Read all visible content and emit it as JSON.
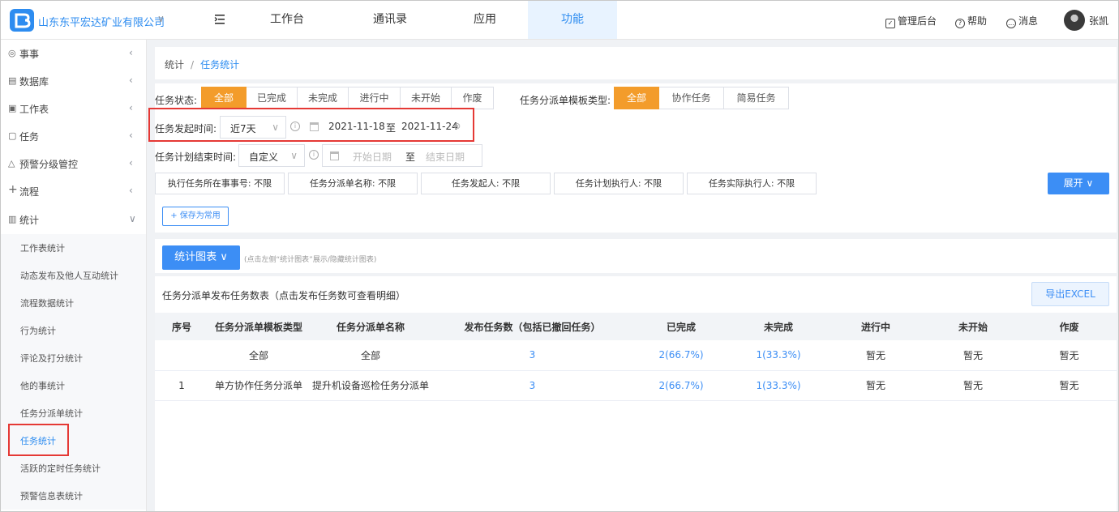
{
  "header": {
    "company": "山东东平宏达矿业有限公司",
    "nav": [
      "工作台",
      "通讯录",
      "应用",
      "功能"
    ],
    "active_nav": "功能",
    "right": {
      "admin": "管理后台",
      "help": "帮助",
      "messages": "消息",
      "user": "张凯"
    }
  },
  "sidebar": {
    "groups": [
      {
        "icon": "inbox-icon",
        "label": "事事"
      },
      {
        "icon": "database-icon",
        "label": "数据库"
      },
      {
        "icon": "worksheet-icon",
        "label": "工作表"
      },
      {
        "icon": "task-icon",
        "label": "任务"
      },
      {
        "icon": "alert-icon",
        "label": "预警分级管控"
      },
      {
        "icon": "flow-icon",
        "label": "流程"
      },
      {
        "icon": "chart-icon",
        "label": "统计"
      }
    ],
    "sub_items": [
      "工作表统计",
      "动态发布及他人互动统计",
      "流程数据统计",
      "行为统计",
      "评论及打分统计",
      "他的事统计",
      "任务分派单统计",
      "任务统计",
      "活跃的定时任务统计",
      "预警信息表统计"
    ],
    "active_sub": "任务统计"
  },
  "breadcrumb": {
    "root": "统计",
    "separator": "/",
    "current": "任务统计"
  },
  "filters": {
    "status_label": "任务状态:",
    "status_options": [
      "全部",
      "已完成",
      "未完成",
      "进行中",
      "未开始",
      "作废"
    ],
    "status_selected": "全部",
    "template_label": "任务分派单模板类型:",
    "template_options": [
      "全部",
      "协作任务",
      "简易任务"
    ],
    "template_selected": "全部",
    "start_label": "任务发起时间:",
    "start_preset": "近7天",
    "start_from": "2021-11-18",
    "start_to_sep": "至",
    "start_to": "2021-11-24",
    "end_label": "任务计划结束时间:",
    "end_preset": "自定义",
    "end_from_placeholder": "开始日期",
    "end_to_sep": "至",
    "end_to_placeholder": "结束日期",
    "chips": [
      "执行任务所在事事号: 不限",
      "任务分派单名称: 不限",
      "任务发起人: 不限",
      "任务计划执行人: 不限",
      "任务实际执行人: 不限"
    ],
    "expand_label": "展开",
    "save_label": "+ 保存为常用"
  },
  "chart_toggle": {
    "label": "统计图表",
    "hint": "(点击左侧“统计图表”展示/隐藏统计图表)"
  },
  "table": {
    "title": "任务分派单发布任务数表（点击发布任务数可查看明细）",
    "export_label": "导出EXCEL",
    "columns": [
      "序号",
      "任务分派单模板类型",
      "任务分派单名称",
      "发布任务数（包括已撤回任务）",
      "已完成",
      "未完成",
      "进行中",
      "未开始",
      "作废"
    ],
    "rows": [
      [
        "",
        "全部",
        "全部",
        "3",
        "2(66.7%)",
        "1(33.3%)",
        "暂无",
        "暂无",
        "暂无"
      ],
      [
        "1",
        "单方协作任务分派单",
        "提升机设备巡检任务分派单",
        "3",
        "2(66.7%)",
        "1(33.3%)",
        "暂无",
        "暂无",
        "暂无"
      ]
    ]
  },
  "colors": {
    "accent": "#3c8ef5",
    "selected": "#f39c2b",
    "highlight_box": "#e53935"
  }
}
